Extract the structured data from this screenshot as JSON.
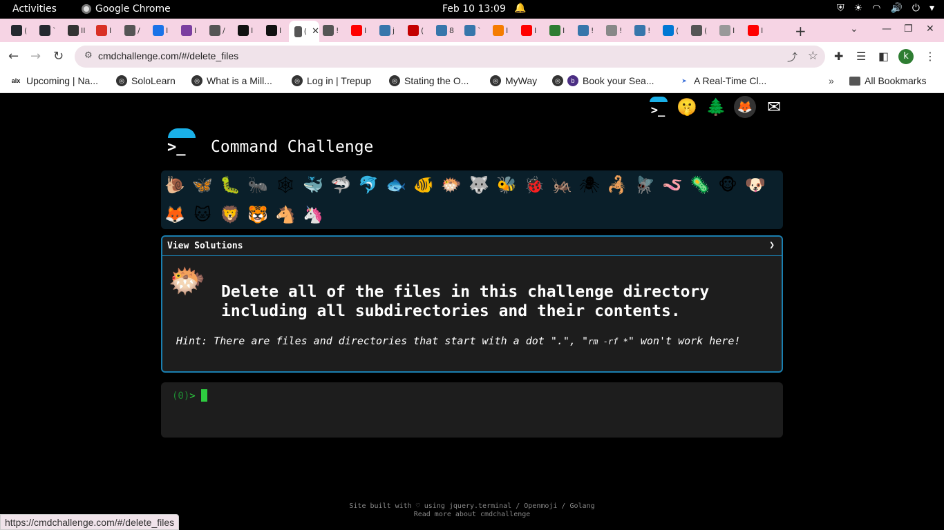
{
  "topbar": {
    "activities": "Activities",
    "app_name": "Google Chrome",
    "clock": "Feb 10  13:09"
  },
  "tabs": [
    {
      "icon": "github-icon",
      "color": "#24292f",
      "label": "("
    },
    {
      "icon": "github-icon",
      "color": "#24292f",
      "label": "`"
    },
    {
      "icon": "pause-audio-icon",
      "color": "#333333",
      "label": "II"
    },
    {
      "icon": "gmail-icon",
      "color": "#d93025",
      "label": "I"
    },
    {
      "icon": "globe-icon",
      "color": "#555555",
      "label": "/"
    },
    {
      "icon": "globe-icon",
      "color": "#1a73e8",
      "label": "I"
    },
    {
      "icon": "globe-icon",
      "color": "#7b3fa0",
      "label": "I"
    },
    {
      "icon": "globe-icon",
      "color": "#555555",
      "label": "/"
    },
    {
      "icon": "alx-icon",
      "color": "#111111",
      "label": "I"
    },
    {
      "icon": "alx-icon",
      "color": "#111111",
      "label": "I"
    },
    {
      "icon": "active-tab-icon",
      "color": "#555555",
      "label": "("
    },
    {
      "icon": "globe-icon",
      "color": "#555555",
      "label": "!"
    },
    {
      "icon": "youtube-icon",
      "color": "#ff0000",
      "label": "I"
    },
    {
      "icon": "python-icon",
      "color": "#3776ab",
      "label": "j"
    },
    {
      "icon": "pdf-icon",
      "color": "#c40000",
      "label": "("
    },
    {
      "icon": "python-icon",
      "color": "#3776ab",
      "label": "8"
    },
    {
      "icon": "python-icon",
      "color": "#3776ab",
      "label": "`"
    },
    {
      "icon": "flame-icon",
      "color": "#f57c00",
      "label": "I"
    },
    {
      "icon": "youtube-icon",
      "color": "#ff0000",
      "label": "I"
    },
    {
      "icon": "infinity-icon",
      "color": "#2e7d32",
      "label": "I"
    },
    {
      "icon": "python-icon",
      "color": "#3776ab",
      "label": "!"
    },
    {
      "icon": "globe-icon",
      "color": "#888888",
      "label": "!"
    },
    {
      "icon": "python-icon",
      "color": "#3776ab",
      "label": "!"
    },
    {
      "icon": "outlook-icon",
      "color": "#0078d4",
      "label": "("
    },
    {
      "icon": "tab-icon",
      "color": "#555555",
      "label": "("
    },
    {
      "icon": "globe-icon",
      "color": "#999999",
      "label": "I"
    },
    {
      "icon": "youtube-icon",
      "color": "#ff0000",
      "label": "I"
    }
  ],
  "browser": {
    "url": "cmdchallenge.com/#/delete_files",
    "avatar_letter": "k",
    "status_url": "https://cmdchallenge.com/#/delete_files"
  },
  "bookmarks": [
    {
      "label": "Upcoming | Na...",
      "icon": "alx-icon"
    },
    {
      "label": "SoloLearn",
      "icon": "globe-icon"
    },
    {
      "label": "What is a Mill...",
      "icon": "globe-icon"
    },
    {
      "label": "Log in | Trepup",
      "icon": "globe-icon"
    },
    {
      "label": "Stating the O...",
      "icon": "globe-icon"
    },
    {
      "label": "MyWay",
      "icon": "globe-icon"
    },
    {
      "label": "Book your Sea...",
      "icon": "ticket-icon"
    },
    {
      "label": "A Real-Time Cl...",
      "icon": "bird-icon"
    },
    {
      "label": "All Bookmarks",
      "icon": "folder-icon"
    }
  ],
  "site": {
    "title": "Command Challenge",
    "logo_prompt": ">_"
  },
  "levels": [
    {
      "glyph": "🐌",
      "name": "snail"
    },
    {
      "glyph": "🦋",
      "name": "butterfly"
    },
    {
      "glyph": "🐛",
      "name": "caterpillar"
    },
    {
      "glyph": "🐜",
      "name": "ant"
    },
    {
      "glyph": "🕸",
      "name": "spider-web"
    },
    {
      "glyph": "🐳",
      "name": "whale"
    },
    {
      "glyph": "🦈",
      "name": "shark"
    },
    {
      "glyph": "🐬",
      "name": "dolphin"
    },
    {
      "glyph": "🐟",
      "name": "fish"
    },
    {
      "glyph": "🐠",
      "name": "tropical-fish"
    },
    {
      "glyph": "🐡",
      "name": "blowfish"
    },
    {
      "glyph": "🐺",
      "name": "wolf"
    },
    {
      "glyph": "🐝",
      "name": "bee"
    },
    {
      "glyph": "🐞",
      "name": "ladybug"
    },
    {
      "glyph": "🦗",
      "name": "cricket"
    },
    {
      "glyph": "🕷",
      "name": "spider"
    },
    {
      "glyph": "🦂",
      "name": "scorpion"
    },
    {
      "glyph": "🪰",
      "name": "fly"
    },
    {
      "glyph": "🪱",
      "name": "worm"
    },
    {
      "glyph": "🦠",
      "name": "microbe"
    },
    {
      "glyph": "🐵",
      "name": "monkey"
    },
    {
      "glyph": "🐶",
      "name": "dog"
    },
    {
      "glyph": "🦊",
      "name": "fox"
    },
    {
      "glyph": "🐱",
      "name": "cat"
    },
    {
      "glyph": "🦁",
      "name": "lion"
    },
    {
      "glyph": "🐯",
      "name": "tiger"
    },
    {
      "glyph": "🐴",
      "name": "horse"
    },
    {
      "glyph": "🦄",
      "name": "unicorn"
    }
  ],
  "challenge": {
    "view_solutions": "View Solutions",
    "expand_arrow": "❯",
    "icon_glyph": "🐡",
    "task_line1": "Delete all of the files in this challenge directory",
    "task_line2": "including all subdirectories and their contents.",
    "hint_prefix": "Hint: There are files and directories that start with a dot \".\", \"",
    "hint_code": "rm -rf *",
    "hint_suffix": "\" won't work here!"
  },
  "terminal": {
    "exit_code": "(0)",
    "prompt_symbol": ">"
  },
  "footer": {
    "line1": "Site built with ♡ using jquery.terminal / Openmoji / Golang",
    "line2": "Read more about cmdchallenge"
  },
  "colors": {
    "accent_blue": "#1ab0e8",
    "panel_border": "#1a7fb0",
    "terminal_green": "#2ecc40",
    "tabstrip_pink": "#f6d4e4"
  }
}
